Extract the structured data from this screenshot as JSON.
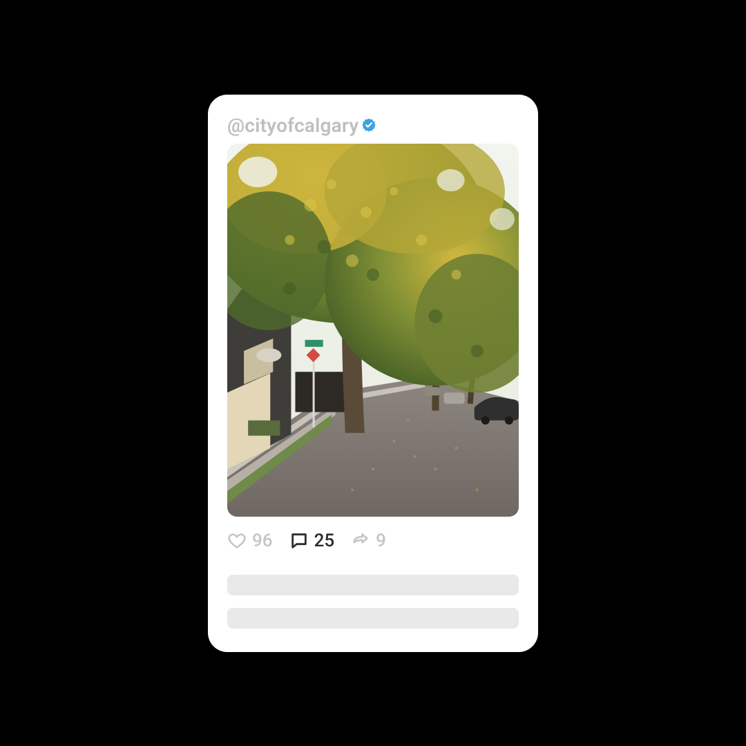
{
  "post": {
    "handle": "@cityofcalgary",
    "verified": true,
    "image_alt": "Tree-lined residential street in autumn with yellow and green foliage, houses on the left, parked cars along the road",
    "engagement": {
      "likes": "96",
      "comments": "25",
      "shares": "9"
    }
  },
  "colors": {
    "verified_badge": "#3ea3df",
    "muted_text": "#c5c5c5",
    "active_text": "#2b2b2b",
    "placeholder": "#e9e9e9"
  }
}
